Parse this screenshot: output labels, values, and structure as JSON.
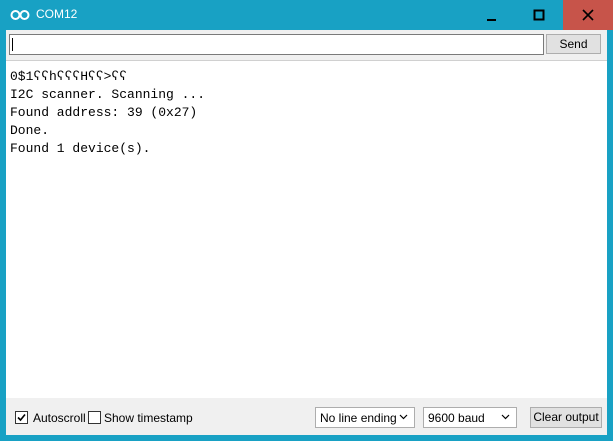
{
  "window": {
    "title": "COM12",
    "icon": "arduino-infinity-icon",
    "colors": {
      "titlebar": "#18a1c4",
      "close": "#c7544a"
    }
  },
  "controls": {
    "minimize": "minimize-icon",
    "maximize": "maximize-icon",
    "close": "close-icon"
  },
  "send_bar": {
    "input_value": "",
    "send_label": "Send"
  },
  "output": {
    "lines": [
      "0$1ʕʕhʕʕʕHʕʕ>ʕʕ",
      "I2C scanner. Scanning ...",
      "Found address: 39 (0x27)",
      "Done.",
      "Found 1 device(s)."
    ]
  },
  "status_bar": {
    "autoscroll": {
      "label": "Autoscroll",
      "checked": true
    },
    "show_timestamp": {
      "label": "Show timestamp",
      "checked": false
    },
    "line_ending": "No line ending",
    "baud": "9600 baud",
    "clear_label": "Clear output"
  }
}
